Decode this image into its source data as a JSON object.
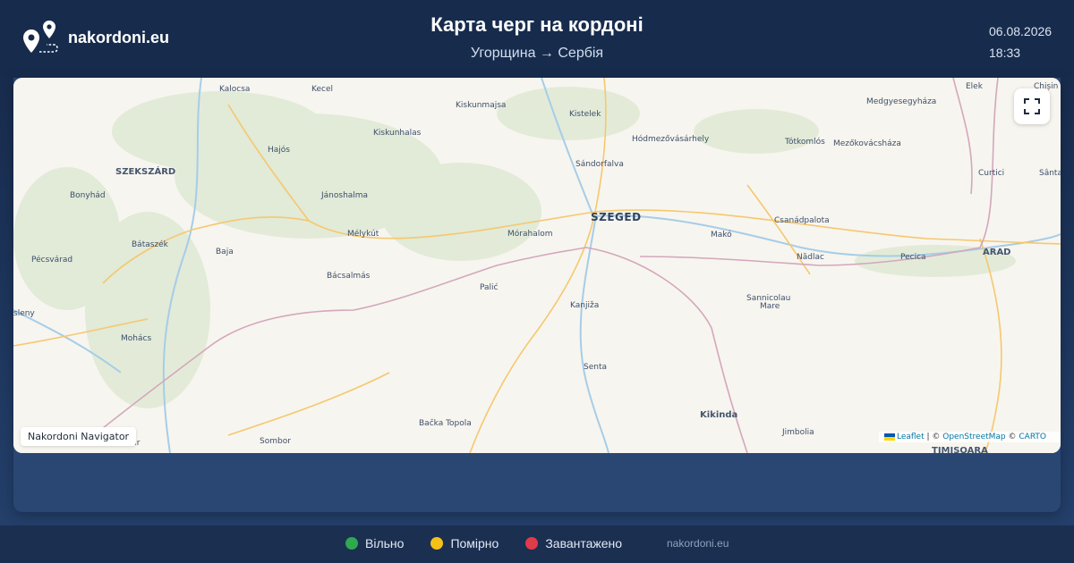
{
  "header": {
    "brand": "nakordoni.eu",
    "title": "Карта черг на кордоні",
    "route": "Угорщина → Сербія",
    "date": "06.08.2026",
    "time": "18:33"
  },
  "map": {
    "cities": {
      "kalocsa": "Kalocsa",
      "kecel": "Kecel",
      "kiskunmajsa": "Kiskunmajsa",
      "kistelek": "Kistelek",
      "elek": "Elek",
      "chisineu": "Chișin",
      "medgyesegyhaza": "Medgyesegyháza",
      "kiskunhalas": "Kiskunhalas",
      "hodmezovasarhely": "Hódmezővásárhely",
      "totkomlos": "Tótkomlós",
      "mezokovacshaza": "Mezőkovácsháza",
      "hajos": "Hajós",
      "sandorfalva": "Sándorfalva",
      "szekszard": "SZEKSZÁRD",
      "curtici": "Curtici",
      "santana": "Sânta",
      "bonyhad": "Bonyhád",
      "janoshalma": "Jánoshalma",
      "szeged": "SZEGED",
      "csanadpalota": "Csanádpalota",
      "melykut": "Mélykút",
      "morahalom": "Mórahalom",
      "mako": "Makó",
      "arad": "ARAD",
      "bataszek": "Bátaszék",
      "baja": "Baja",
      "nadlac": "Nădlac",
      "pecica": "Pecica",
      "pecsvarad": "Pécsvárad",
      "bacsalmas": "Bácsalmás",
      "palic": "Palić",
      "sannicolau": "Sannicolau",
      "mare": "Mare",
      "kanjiza": "Kanjiža",
      "siklos": "sleny",
      "mohacs": "Mohács",
      "senta": "Senta",
      "kikinda": "Kikinda",
      "backa_topola": "Bačka Topola",
      "jimbolia": "Jimbolia",
      "sombor": "Sombor",
      "apatin": "utir",
      "timisoara": "TIMIȘOARA"
    },
    "badge": "Nakordoni Navigator",
    "attribution": {
      "leaflet": "Leaflet",
      "sep1": " | © ",
      "osm": "OpenStreetMap",
      "sep2": " © ",
      "carto": "CARTO"
    },
    "fullscreen_icon": "fullscreen-icon"
  },
  "legend": [
    {
      "label": "Вільно",
      "color": "#2fa84f"
    },
    {
      "label": "Помірно",
      "color": "#f5c017"
    },
    {
      "label": "Завантажено",
      "color": "#e03b4a"
    }
  ],
  "footer": {
    "site": "nakordoni.eu"
  },
  "colors": {
    "header_bg": "#172c4d",
    "card_bg": "#2a4672",
    "footer_bg": "#1b2f51",
    "river": "#a6cde8",
    "road": "#f5c86e",
    "border": "#d3a7bd"
  }
}
